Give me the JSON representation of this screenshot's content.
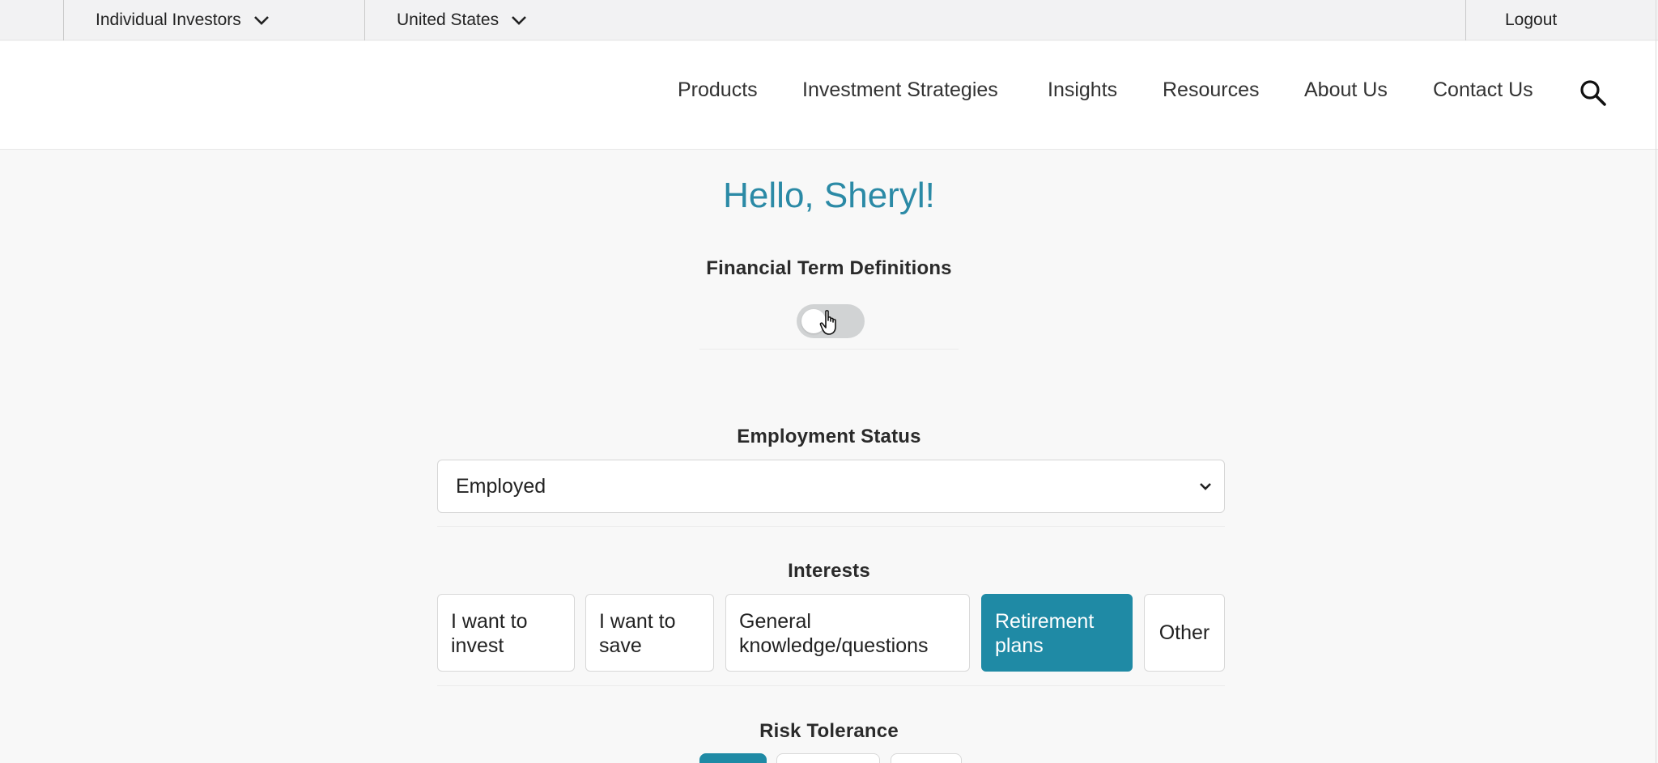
{
  "topbar": {
    "audience_label": "Individual Investors",
    "region_label": "United States",
    "logout_label": "Logout"
  },
  "nav": {
    "items": [
      "Products",
      "Investment Strategies",
      "Insights",
      "Resources",
      "About Us",
      "Contact Us"
    ],
    "search_icon": "search-icon"
  },
  "greeting": "Hello, Sheryl!",
  "financial_terms": {
    "title": "Financial Term Definitions",
    "toggle_on": false
  },
  "employment": {
    "title": "Employment Status",
    "selected": "Employed"
  },
  "interests": {
    "title": "Interests",
    "options": [
      {
        "label": "I want to invest",
        "selected": false
      },
      {
        "label": "I want to save",
        "selected": false
      },
      {
        "label": "General knowledge/questions",
        "selected": false
      },
      {
        "label": "Retirement plans",
        "selected": true
      },
      {
        "label": "Other",
        "selected": false
      }
    ]
  },
  "risk": {
    "title": "Risk Tolerance"
  },
  "colors": {
    "accent": "#1f8aa5",
    "greeting": "#2b8aa6",
    "toggle_off": "#d1d3d4"
  }
}
